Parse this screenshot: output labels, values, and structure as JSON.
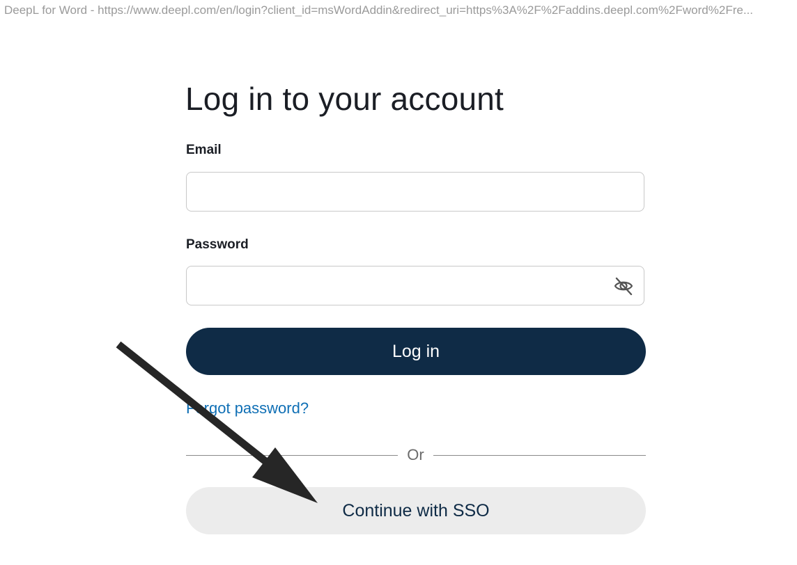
{
  "window": {
    "title": "DeepL for Word - https://www.deepl.com/en/login?client_id=msWordAddin&redirect_uri=https%3A%2F%2Faddins.deepl.com%2Fword%2Fre..."
  },
  "login_form": {
    "heading": "Log in to your account",
    "email_label": "Email",
    "email_value": "",
    "password_label": "Password",
    "password_value": "",
    "password_toggle_icon": "eye-slash-icon",
    "login_button": "Log in",
    "forgot_password": "Forgot password?",
    "divider_text": "Or",
    "sso_button": "Continue with SSO"
  },
  "colors": {
    "primary": "#0f2b46",
    "link": "#0f6fb5",
    "secondary_button": "#ececec",
    "annotation_arrow": "#262626"
  }
}
